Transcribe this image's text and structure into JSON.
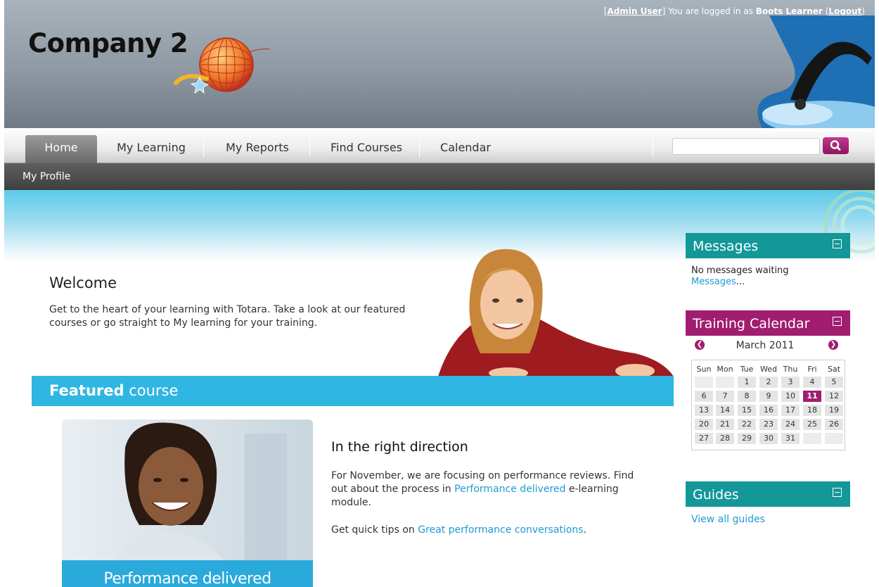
{
  "header": {
    "admin_user": "Admin User",
    "logged_in_prefix": " You are logged in as ",
    "username": "Boots Learner",
    "logout": "Logout",
    "logo_text": "Company 2"
  },
  "nav": {
    "tabs": [
      "Home",
      "My Learning",
      "My Reports",
      "Find Courses",
      "Calendar"
    ],
    "active_tab": "Home",
    "search_placeholder": "",
    "subnav_item": "My Profile"
  },
  "welcome": {
    "title": "Welcome",
    "text": "Get to the heart of your learning with Totara. Take a look at our featured courses or go straight to My learning for your training."
  },
  "featured": {
    "label_bold": "Featured",
    "label_rest": " course",
    "image_caption": "Performance delivered",
    "course_title": "In the right direction",
    "para1_text": "For November, we are focusing on performance reviews. Find out about the process in ",
    "para1_link": "Performance delivered",
    "para1_suffix": " e-learning module.",
    "para2_text": "Get quick tips on ",
    "para2_link": "Great performance conversations",
    "para2_suffix": "."
  },
  "messages": {
    "title": "Messages",
    "status": "No messages waiting",
    "link": "Messages",
    "link_suffix": "..."
  },
  "calendar": {
    "title": "Training Calendar",
    "month": "March 2011",
    "day_names": [
      "Sun",
      "Mon",
      "Tue",
      "Wed",
      "Thu",
      "Fri",
      "Sat"
    ],
    "weeks": [
      [
        "",
        "",
        "1",
        "2",
        "3",
        "4",
        "5"
      ],
      [
        "6",
        "7",
        "8",
        "9",
        "10",
        "11",
        "12"
      ],
      [
        "13",
        "14",
        "15",
        "16",
        "17",
        "18",
        "19"
      ],
      [
        "20",
        "21",
        "22",
        "23",
        "24",
        "25",
        "26"
      ],
      [
        "27",
        "28",
        "29",
        "30",
        "31",
        "",
        ""
      ]
    ],
    "today": "11"
  },
  "guides": {
    "title": "Guides",
    "link": "View all guides"
  },
  "colors": {
    "teal": "#139799",
    "magenta": "#a11d6f",
    "cyan": "#2fb6e3",
    "link": "#1e9bd3"
  }
}
